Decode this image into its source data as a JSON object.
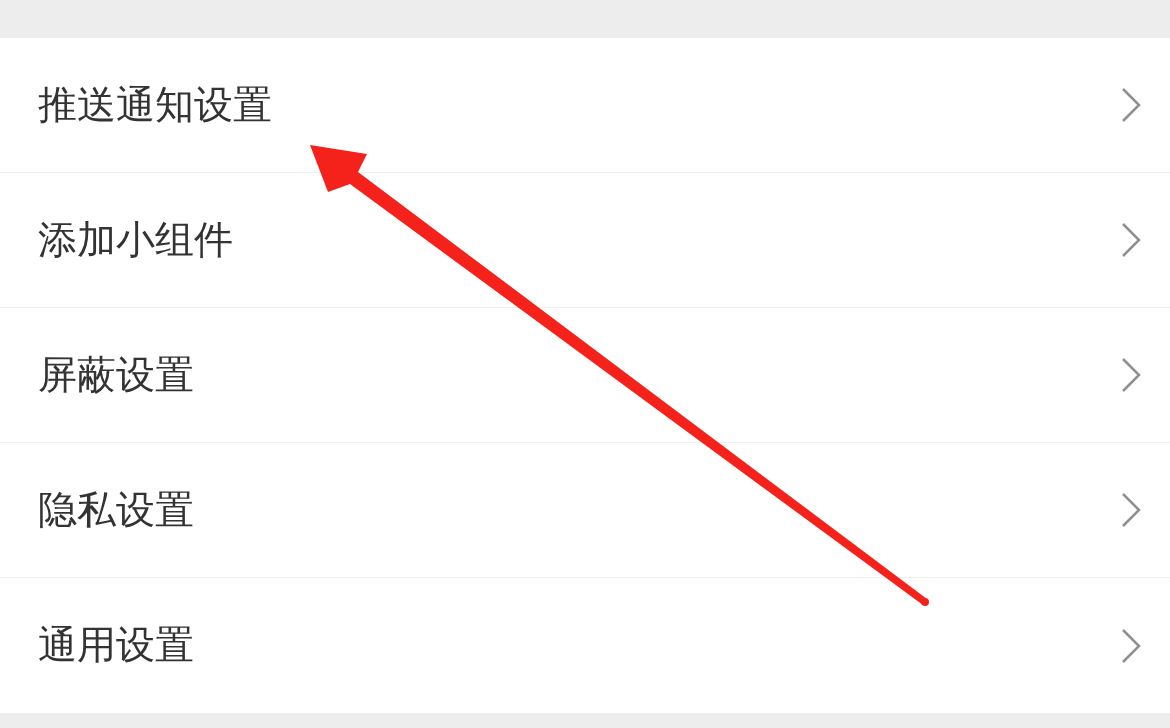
{
  "rows": [
    {
      "label": "推送通知设置"
    },
    {
      "label": "添加小组件"
    },
    {
      "label": "屏蔽设置"
    },
    {
      "label": "隐私设置"
    },
    {
      "label": "通用设置"
    }
  ]
}
